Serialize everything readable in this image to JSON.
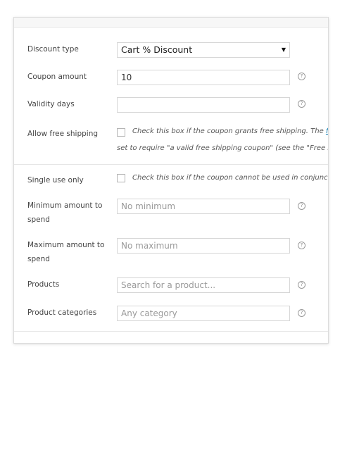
{
  "fields": {
    "discount_type": {
      "label": "Discount type",
      "value": "Cart % Discount"
    },
    "coupon_amount": {
      "label": "Coupon amount",
      "value": "10"
    },
    "validity_days": {
      "label": "Validity days",
      "value": ""
    },
    "free_shipping": {
      "label": "Allow free shipping",
      "desc_line1": "Check this box if the coupon grants free shipping. The ",
      "desc_link": "fre",
      "desc_line2": "set to require \"a valid free shipping coupon\" (see the \"Free Sh"
    },
    "single_use": {
      "label": "Single use only",
      "desc": "Check this box if the coupon cannot be used in conjuncti"
    },
    "min_amount": {
      "label_line1": "Minimum amount to",
      "label_line2": "spend",
      "placeholder": "No minimum"
    },
    "max_amount": {
      "label_line1": "Maximum amount to",
      "label_line2": "spend",
      "placeholder": "No maximum"
    },
    "products": {
      "label": "Products",
      "placeholder": "Search for a product..."
    },
    "product_categories": {
      "label": "Product categories",
      "placeholder": "Any category"
    }
  },
  "icons": {
    "help": "question-circle-icon",
    "dropdown": "dropdown-arrow-icon"
  },
  "help_glyph": "?",
  "arrow_glyph": "▼"
}
